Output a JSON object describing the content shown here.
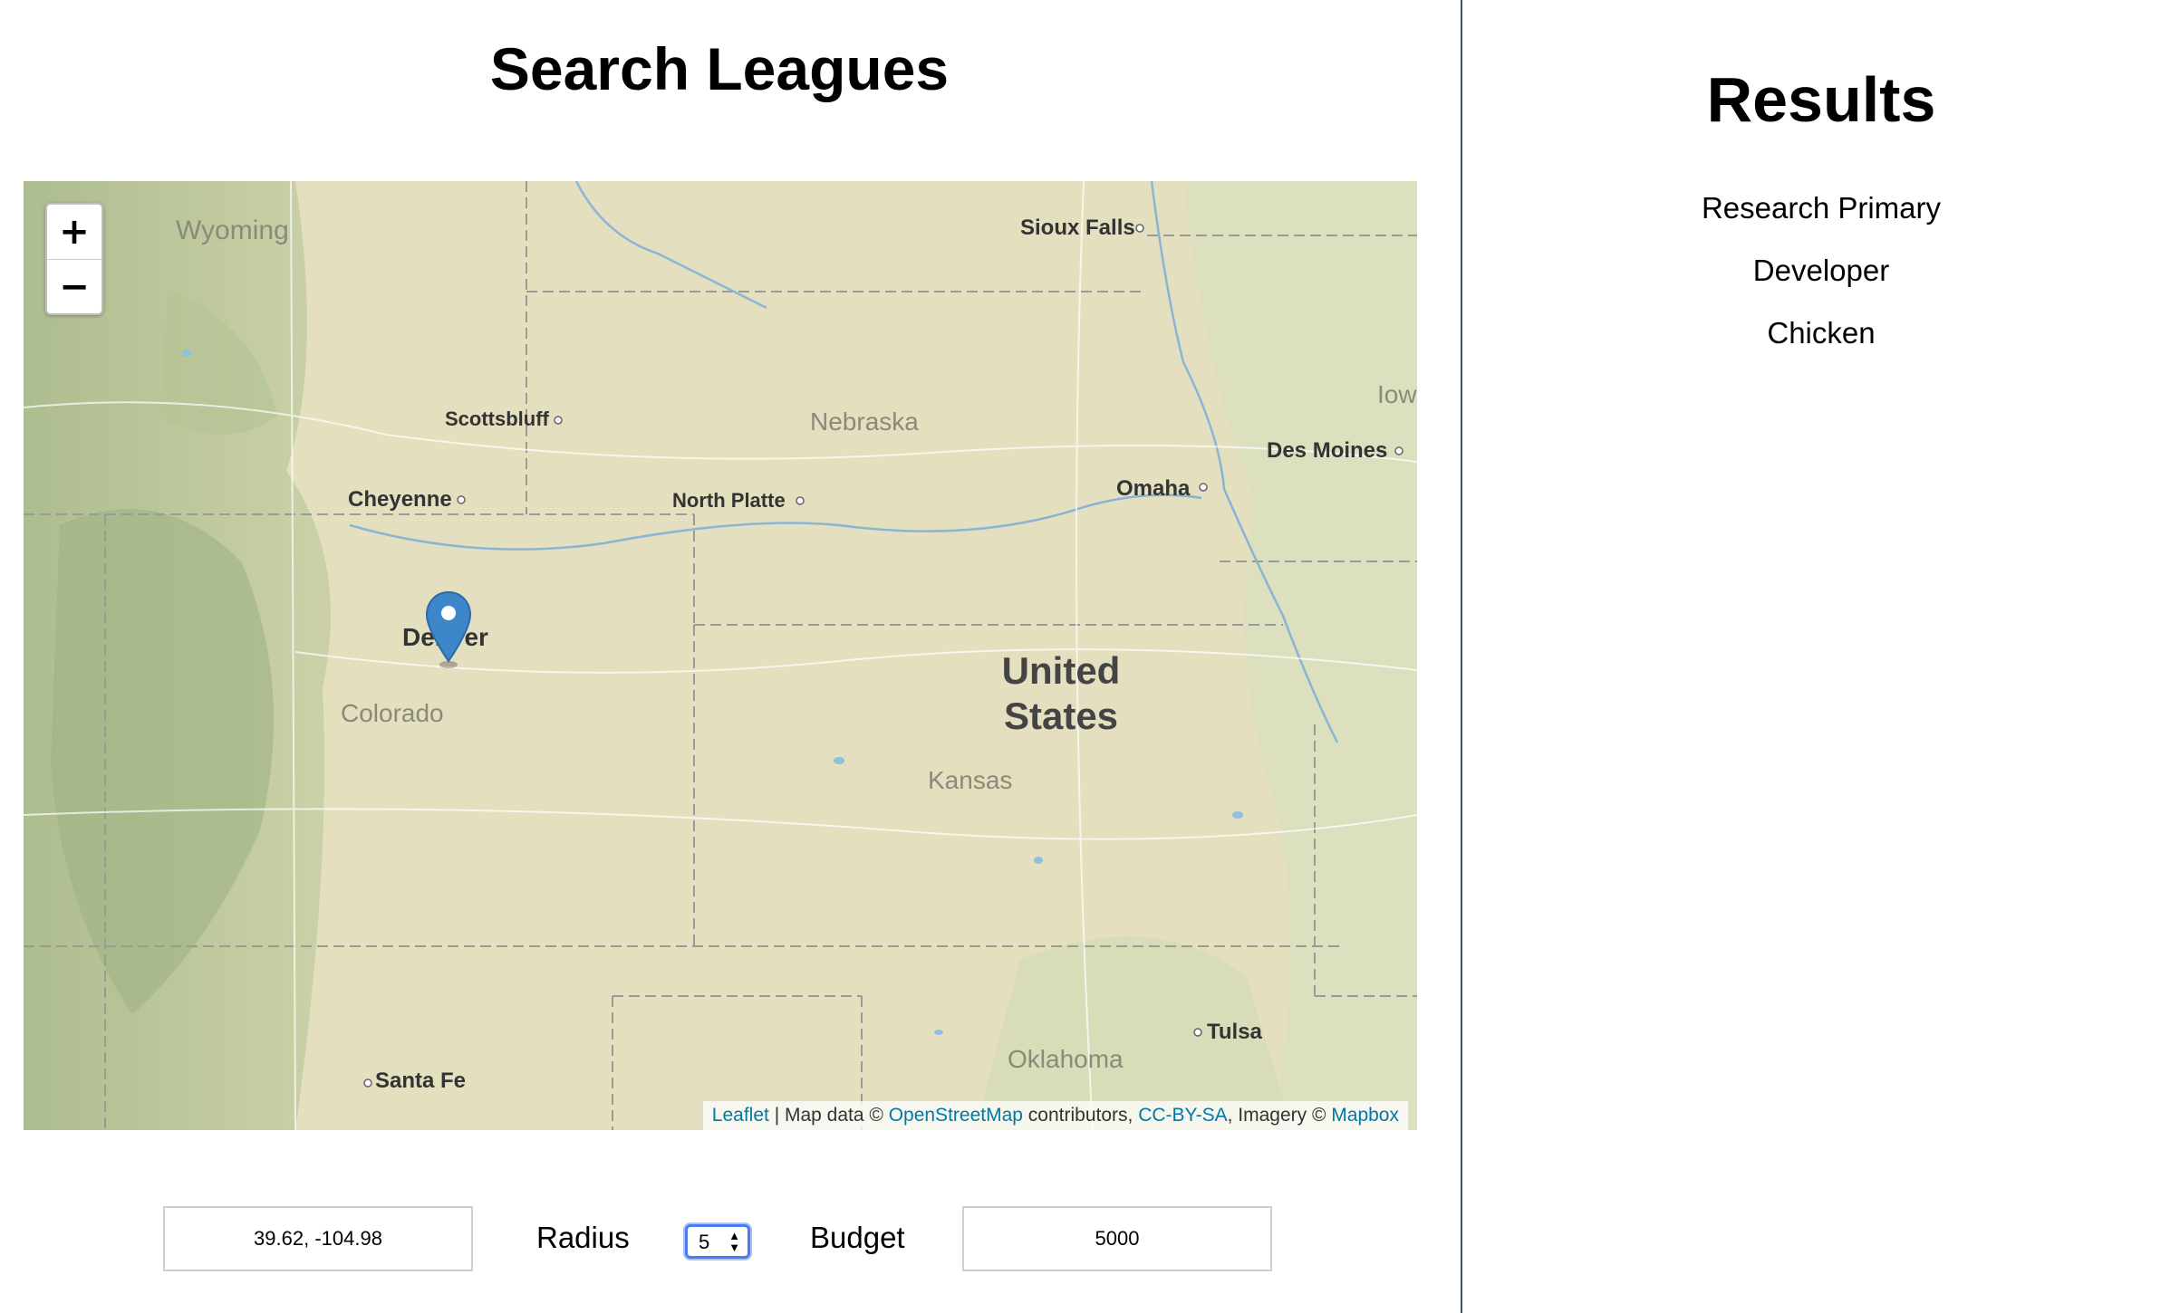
{
  "search": {
    "title": "Search Leagues"
  },
  "map": {
    "zoom_in": "+",
    "zoom_out": "−",
    "places": {
      "wyoming": "Wyoming",
      "sioux_falls": "Sioux Falls",
      "nebraska": "Nebraska",
      "scottsbluff": "Scottsbluff",
      "cheyenne": "Cheyenne",
      "north_platte": "North Platte",
      "omaha": "Omaha",
      "des_moines": "Des Moines",
      "iowa": "Iow",
      "denver": "Denver",
      "colorado": "Colorado",
      "us_line1": "United",
      "us_line2": "States",
      "kansas": "Kansas",
      "oklahoma": "Oklahoma",
      "tulsa": "Tulsa",
      "santa_fe": "Santa Fe"
    },
    "attribution": {
      "leaflet": "Leaflet",
      "map_data": " | Map data © ",
      "osm": "OpenStreetMap",
      "contributors": " contributors, ",
      "ccbysa": "CC-BY-SA",
      "imagery": ", Imagery © ",
      "mapbox": "Mapbox"
    },
    "marker_icon": "map-pin-icon",
    "colors": {
      "land": "#e4dfbf",
      "marker": "#3d86c9",
      "link": "#0078a8"
    }
  },
  "controls": {
    "coordinates_value": "39.62, -104.98",
    "radius_label": "Radius",
    "radius_value": "5",
    "budget_label": "Budget",
    "budget_value": "5000"
  },
  "results": {
    "title": "Results",
    "items": [
      "Research Primary",
      "Developer",
      "Chicken"
    ]
  }
}
